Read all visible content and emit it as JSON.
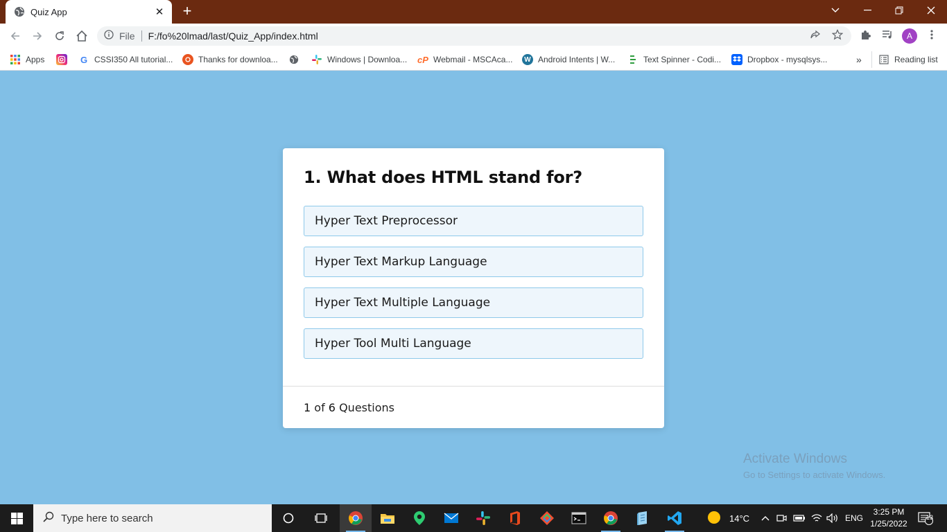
{
  "browser": {
    "tab_title": "Quiz App",
    "tab_close": "✕",
    "new_tab": "+",
    "url_scheme": "File",
    "url": "F:/fo%20lmad/last/Quiz_App/index.html",
    "profile_initial": "A",
    "window_controls": [
      "minimize",
      "restore",
      "close"
    ]
  },
  "bookmarks": {
    "items": [
      {
        "label": "Apps",
        "icon": "apps-grid-icon"
      },
      {
        "label": "",
        "icon": "instagram-icon"
      },
      {
        "label": "CSSI350 All tutorial...",
        "icon": "google-icon"
      },
      {
        "label": "Thanks for downloa...",
        "icon": "ubuntu-icon"
      },
      {
        "label": "",
        "icon": "globe-icon"
      },
      {
        "label": "Windows | Downloa...",
        "icon": "slack-icon"
      },
      {
        "label": "Webmail - MSCAca...",
        "icon": "cpanel-icon"
      },
      {
        "label": "Android Intents | W...",
        "icon": "wordpress-icon"
      },
      {
        "label": "Text Spinner - Codi...",
        "icon": "spinner-icon"
      },
      {
        "label": "Dropbox - mysqlsys...",
        "icon": "dropbox-icon"
      }
    ],
    "overflow": "»",
    "reading_list": "Reading list"
  },
  "quiz": {
    "question": "1. What does HTML stand for?",
    "options": [
      "Hyper Text Preprocessor",
      "Hyper Text Markup Language",
      "Hyper Text Multiple Language",
      "Hyper Tool Multi Language"
    ],
    "current": "1",
    "of_word": "of",
    "total": "6",
    "questions_word": "Questions"
  },
  "watermark": {
    "title": "Activate Windows",
    "subtitle": "Go to Settings to activate Windows."
  },
  "taskbar": {
    "search_placeholder": "Type here to search",
    "weather_temp": "14°C",
    "language": "ENG",
    "time": "3:25 PM",
    "date": "1/25/2022",
    "notification_count": "13"
  },
  "colors": {
    "page_background": "#81bfe6",
    "option_background": "#eef6fc",
    "option_border": "#8ec9ea",
    "tabstrip": "#6b2a10"
  }
}
